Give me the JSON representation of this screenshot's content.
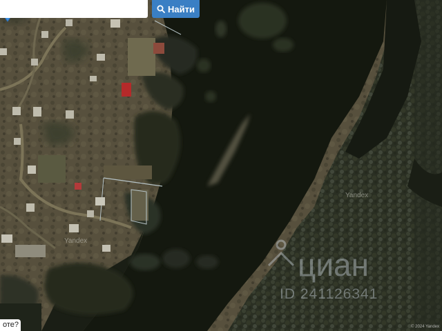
{
  "search": {
    "placeholder": "",
    "value": "",
    "button_label": "Найти",
    "button_icon": "magnifier-icon",
    "button_color": "#3a7fc4"
  },
  "map": {
    "type": "satellite",
    "provider_labels": [
      "Yandex",
      "Yandex"
    ],
    "marker_icon": "location-pin-icon",
    "marker_color": "#3c8fe0",
    "river_color": "#12160f",
    "forest_color": "#2b3024",
    "village_ground_color": "#5b5440"
  },
  "watermark": {
    "brand": "циан",
    "listing_id": "ID 241126341"
  },
  "footer": {
    "question_text": "оте?",
    "copyright": "© 2024 Yandex"
  }
}
